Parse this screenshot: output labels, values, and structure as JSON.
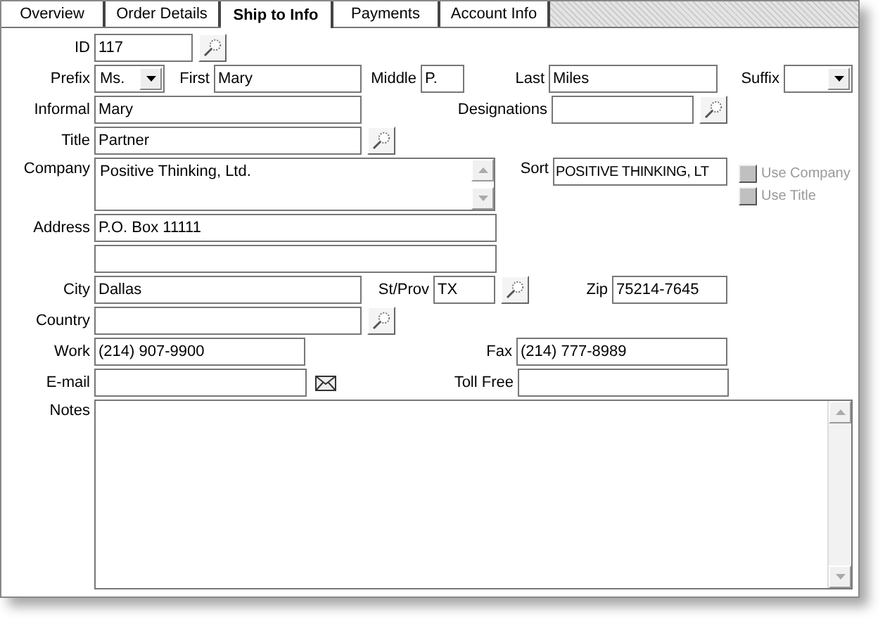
{
  "tabs": [
    {
      "label": "Overview",
      "selected": false
    },
    {
      "label": "Order Details",
      "selected": false
    },
    {
      "label": "Ship to Info",
      "selected": true
    },
    {
      "label": "Payments",
      "selected": false
    },
    {
      "label": "Account Info",
      "selected": false
    }
  ],
  "form": {
    "id": {
      "label": "ID",
      "value": "117"
    },
    "prefix": {
      "label": "Prefix",
      "value": "Ms."
    },
    "first": {
      "label": "First",
      "value": "Mary"
    },
    "middle": {
      "label": "Middle",
      "value": "P."
    },
    "last": {
      "label": "Last",
      "value": "Miles"
    },
    "suffix": {
      "label": "Suffix"
    },
    "informal": {
      "label": "Informal",
      "value": "Mary"
    },
    "designations": {
      "label": "Designations"
    },
    "title": {
      "label": "Title",
      "value": "Partner"
    },
    "company": {
      "label": "Company",
      "value": "Positive Thinking, Ltd."
    },
    "sort": {
      "label": "Sort",
      "value": "POSITIVE THINKING, LT"
    },
    "address": {
      "label": "Address",
      "value": "P.O. Box 11111"
    },
    "city": {
      "label": "City",
      "value": "Dallas"
    },
    "st_prov": {
      "label": "St/Prov",
      "value": "TX"
    },
    "zip": {
      "label": "Zip",
      "value": "75214-7645"
    },
    "country": {
      "label": "Country"
    },
    "work": {
      "label": "Work",
      "value": "(214) 907-9900"
    },
    "fax": {
      "label": "Fax",
      "value": "(214) 777-8989"
    },
    "email": {
      "label": "E-mail"
    },
    "toll_free": {
      "label": "Toll Free"
    },
    "notes": {
      "label": "Notes"
    }
  },
  "checkboxes": [
    {
      "label": "Use Company",
      "checked": false,
      "disabled": true
    },
    {
      "label": "Use Title",
      "checked": false,
      "disabled": true
    }
  ]
}
